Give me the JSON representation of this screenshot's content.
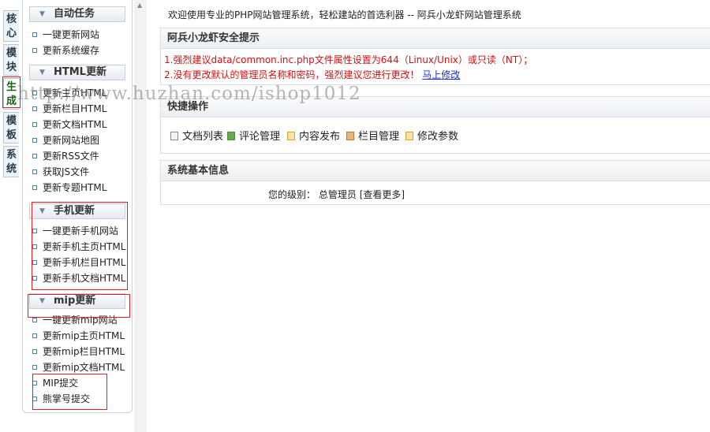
{
  "left_tabs": [
    "核心",
    "模块",
    "生成",
    "模板",
    "系统"
  ],
  "sidebar": {
    "groups": [
      {
        "title": "自动任务",
        "items": [
          "一键更新网站",
          "更新系统缓存"
        ]
      },
      {
        "title": "HTML更新",
        "items": [
          "更新主页HTML",
          "更新栏目HTML",
          "更新文档HTML",
          "更新网站地图",
          "更新RSS文件",
          "获取JS文件",
          "更新专题HTML"
        ]
      },
      {
        "title": "手机更新",
        "items": [
          "一键更新手机网站",
          "更新手机主页HTML",
          "更新手机栏目HTML",
          "更新手机文档HTML"
        ]
      },
      {
        "title": "mip更新",
        "items": [
          "一键更新mip网站",
          "更新mip主页HTML",
          "更新mip栏目HTML",
          "更新mip文档HTML",
          "MIP提交",
          "熊掌号提交"
        ]
      }
    ]
  },
  "welcome": "欢迎使用专业的PHP网站管理系统，轻松建站的首选利器 -- 阿兵小龙虾网站管理系统",
  "security": {
    "title": "阿兵小龙虾安全提示",
    "line1": "1.强烈建议data/common.inc.php文件属性设置为644（Linux/Unix）或只读（NT）；",
    "line2": "2.没有更改默认的管理员名称和密码，强烈建议您进行更改！",
    "line2_link": "马上修改"
  },
  "quick": {
    "title": "快捷操作",
    "actions": [
      {
        "label": "文档列表",
        "icon": "doc-list-icon",
        "color": "#8a8a8a"
      },
      {
        "label": "评论管理",
        "icon": "comment-icon",
        "color": "#4f8a3c"
      },
      {
        "label": "内容发布",
        "icon": "edit-icon",
        "color": "#e0a030"
      },
      {
        "label": "栏目管理",
        "icon": "category-icon",
        "color": "#c07830"
      },
      {
        "label": "修改参数",
        "icon": "settings-icon",
        "color": "#e0a030"
      }
    ]
  },
  "sysinfo": {
    "title": "系统基本信息",
    "level_label": "您的级别：",
    "level_value": "总管理员",
    "more": "[查看更多]"
  },
  "watermark": "http://www.huzhan.com/ishop1012"
}
